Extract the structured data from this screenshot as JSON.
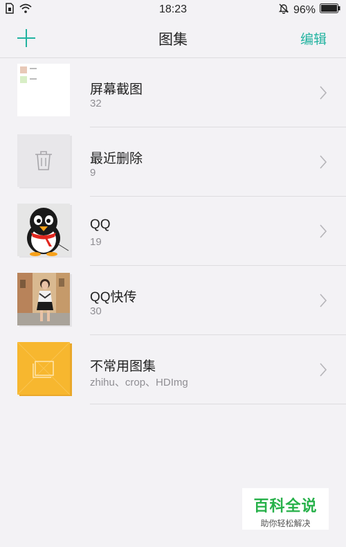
{
  "status_bar": {
    "time": "18:23",
    "battery": "96%",
    "icons": [
      "sim-icon",
      "wifi-icon",
      "bell-muted-icon",
      "battery-icon"
    ]
  },
  "header": {
    "title": "图集",
    "edit_label": "编辑",
    "add_icon": "plus-icon"
  },
  "albums": [
    {
      "name": "屏幕截图",
      "subtitle": "32",
      "thumb": "screenshot"
    },
    {
      "name": "最近删除",
      "subtitle": "9",
      "thumb": "trash-icon"
    },
    {
      "name": "QQ",
      "subtitle": "19",
      "thumb": "penguin"
    },
    {
      "name": "QQ快传",
      "subtitle": "30",
      "thumb": "photo"
    },
    {
      "name": "不常用图集",
      "subtitle": "zhihu、crop、HDImg",
      "thumb": "folder-icon"
    }
  ],
  "watermark": {
    "main": "百科全说",
    "sub": "助你轻松解决"
  },
  "colors": {
    "accent": "#22b3a0",
    "background": "#f3f2f5",
    "folder_yellow": "#f7b72f"
  }
}
